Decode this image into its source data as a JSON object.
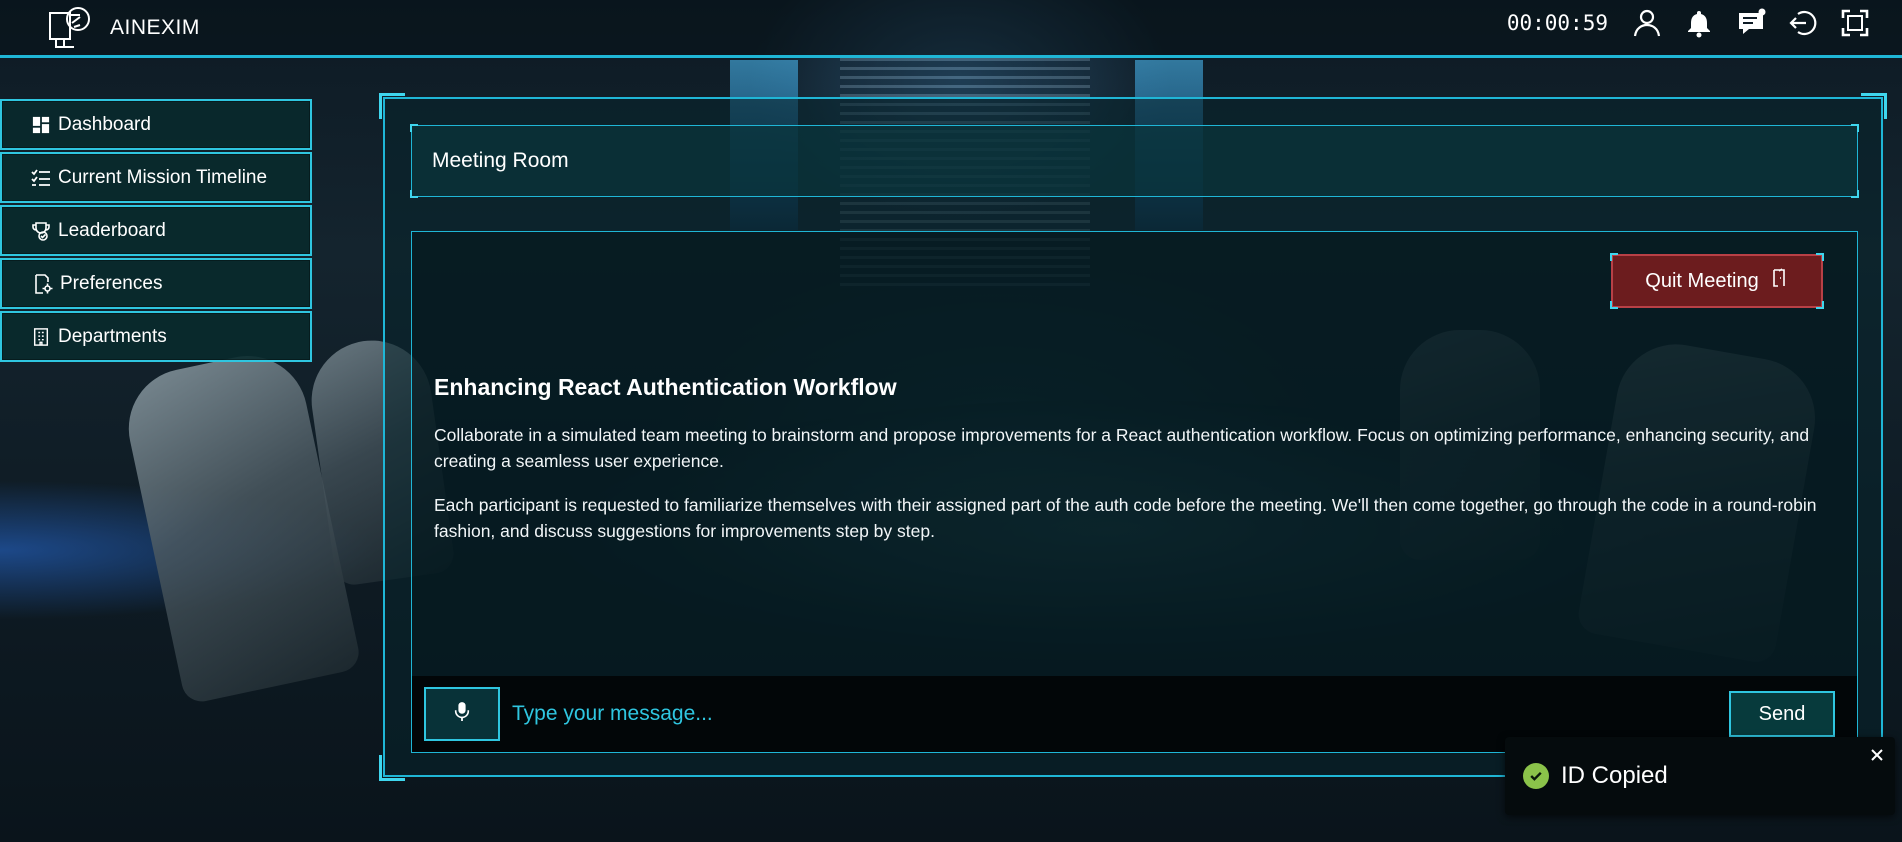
{
  "app": {
    "name": "AINEXIM",
    "timer": "00:00:59"
  },
  "topbar_icons": [
    "profile-icon",
    "bell-icon",
    "chat-icon",
    "logout-icon",
    "fullscreen-icon"
  ],
  "sidebar": {
    "items": [
      {
        "label": "Dashboard",
        "icon": "dashboard-icon"
      },
      {
        "label": "Current Mission Timeline",
        "icon": "checklist-icon"
      },
      {
        "label": "Leaderboard",
        "icon": "leaderboard-icon"
      },
      {
        "label": "Preferences",
        "icon": "preferences-icon"
      },
      {
        "label": "Departments",
        "icon": "building-icon"
      }
    ]
  },
  "room": {
    "title": "Meeting Room",
    "quit_label": "Quit Meeting"
  },
  "mission": {
    "title": "Enhancing React Authentication Workflow",
    "paragraph_1": "Collaborate in a simulated team meeting to brainstorm and propose improvements for a React authentication workflow. Focus on optimizing performance, enhancing security, and creating a seamless user experience.",
    "paragraph_2": "Each participant is requested to familiarize themselves with their assigned part of the auth code before the meeting. We'll then come together, go through the code in a round-robin fashion, and discuss suggestions for improvements step by step."
  },
  "chat": {
    "placeholder": "Type your message...",
    "send_label": "Send"
  },
  "toast": {
    "message": "ID Copied"
  },
  "colors": {
    "accent": "#1fb6d6",
    "quit": "#6c1c1e",
    "success": "#8bc34a"
  }
}
